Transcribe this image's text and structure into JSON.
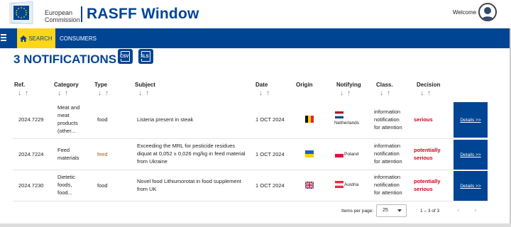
{
  "header": {
    "org_line1": "European",
    "org_line2": "Commission",
    "app_title": "RASFF Window",
    "welcome": "Welcome"
  },
  "nav": {
    "search_label": "SEARCH",
    "consumers_label": "CONSUMERS"
  },
  "main": {
    "title": "3 NOTIFICATIONS",
    "csv_label": "CSV",
    "xls_label": "XLS",
    "columns": [
      "Ref.",
      "Category",
      "Type",
      "Subject",
      "Date",
      "Origin",
      "Notifying",
      "Class.",
      "Decision"
    ],
    "rows": [
      {
        "ref": "2024.7229",
        "category": [
          "Meat and",
          "meat",
          "products",
          "(other..."
        ],
        "type": "food",
        "subject": [
          "Listeria present in steak"
        ],
        "date": "1 OCT 2024",
        "origin_flag": "belgium",
        "notifying_flag": "netherlands",
        "notifying": "Netherlands",
        "class": [
          "information",
          "notification",
          "for attention"
        ],
        "decision": [
          "serious"
        ],
        "details": "Details >>"
      },
      {
        "ref": "2024.7224",
        "category": [
          "Feed",
          "materials"
        ],
        "type": "feed",
        "subject": [
          "Exceeding the MRL for pesticide residues",
          "diquat at 0,052 ± 0,026 mg/kg in feed material",
          "from Ukraine"
        ],
        "date": "1 OCT 2024",
        "origin_flag": "ukraine",
        "notifying_flag": "poland",
        "notifying": "Poland",
        "class": [
          "information",
          "notification",
          "for attention"
        ],
        "decision": [
          "potentially",
          "serious"
        ],
        "details": "Details >>"
      },
      {
        "ref": "2024.7230",
        "category": [
          "Dietetic",
          "foods,",
          "food..."
        ],
        "type": "food",
        "subject": [
          "Novel food Lithiumorotat in food supplement",
          "from UK"
        ],
        "date": "1 OCT 2024",
        "origin_flag": "united-kingdom",
        "notifying_flag": "austria",
        "notifying": "Austria",
        "class": [
          "information",
          "notification",
          "for attention"
        ],
        "decision": [
          "potentially",
          "serious"
        ],
        "details": "Details >>"
      }
    ],
    "pagination": {
      "items_per_page_label": "Items per page:",
      "items_per_page": "25",
      "range": "1 – 3 of 3"
    }
  },
  "colors": {
    "brand_blue": "#004494",
    "accent_yellow": "#ffd617",
    "decision_red": "#d0021b"
  }
}
